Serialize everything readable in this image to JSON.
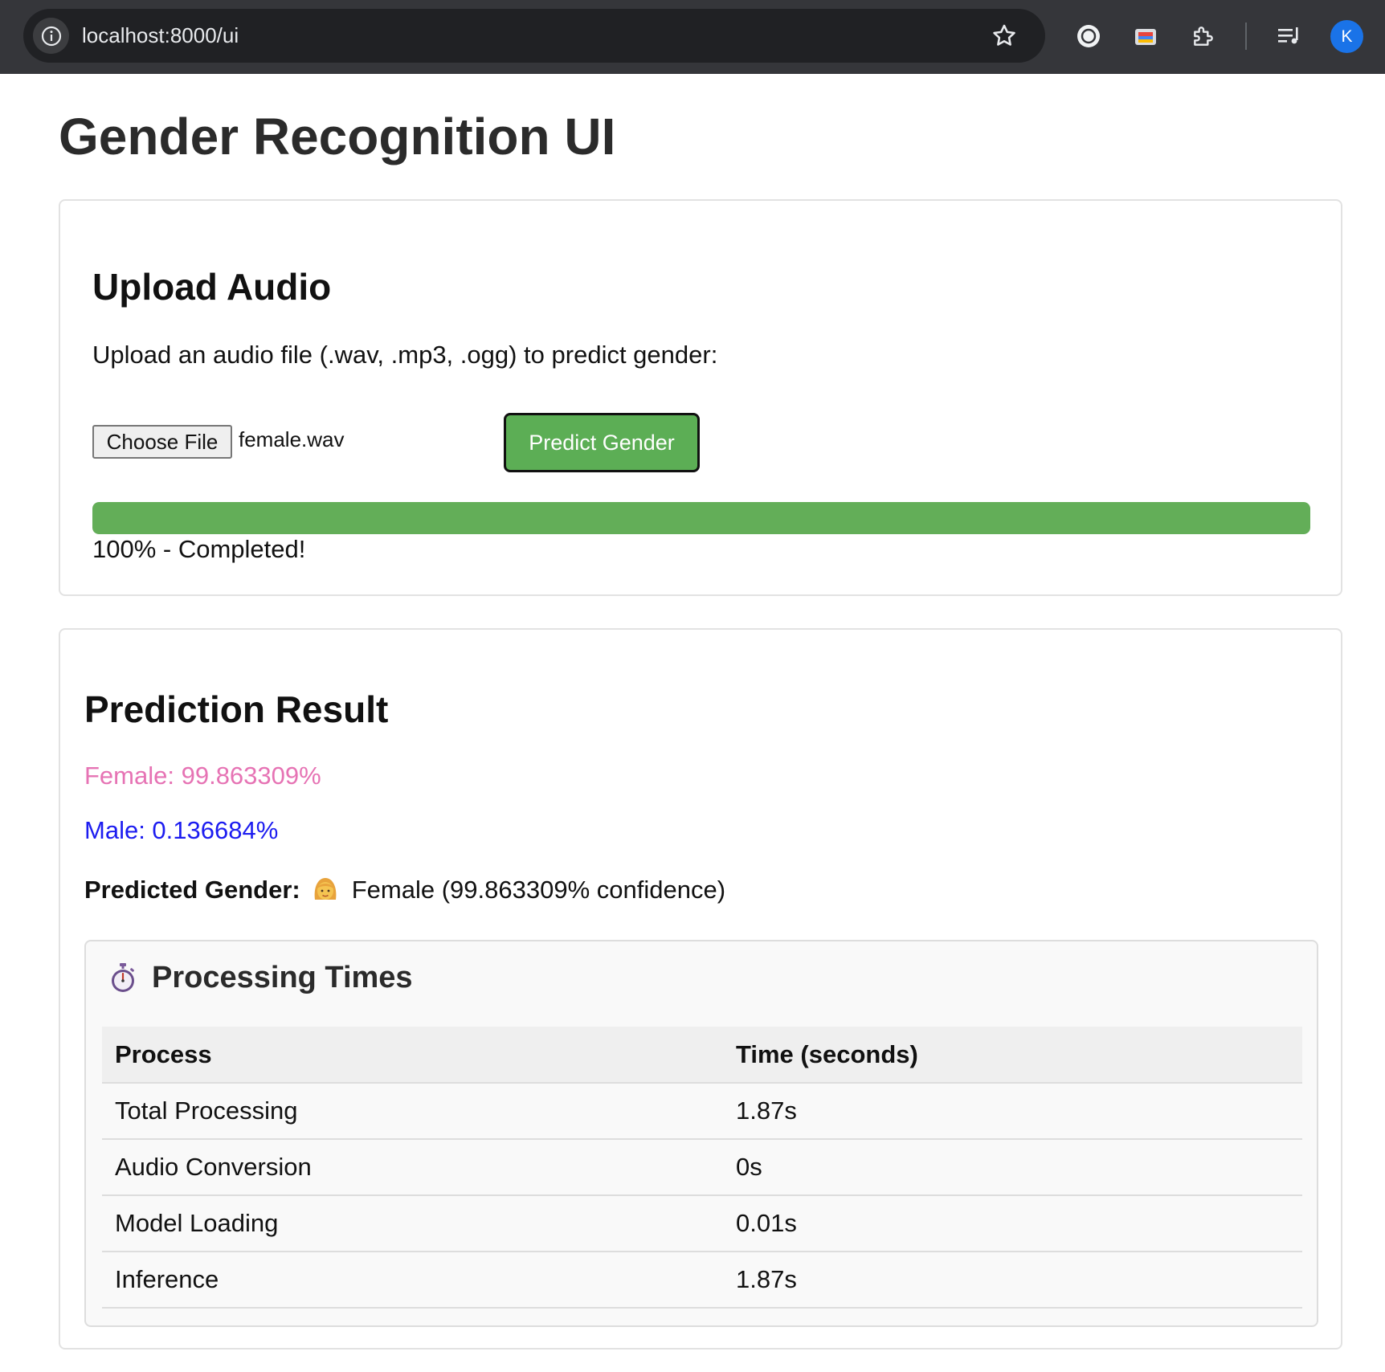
{
  "browser": {
    "url": "localhost:8000/ui",
    "profile_initial": "K",
    "icons": [
      "site-info-icon",
      "bookmark-star-icon",
      "extension-record-icon",
      "extension-palette-icon",
      "extensions-puzzle-icon",
      "reading-list-icon"
    ]
  },
  "page": {
    "title": "Gender Recognition UI"
  },
  "upload": {
    "title": "Upload Audio",
    "description": "Upload an audio file (.wav, .mp3, .ogg) to predict gender:",
    "choose_file_label": "Choose File",
    "file_name": "female.wav",
    "predict_label": "Predict Gender",
    "progress_percent": 100,
    "progress_text": "100% - Completed!",
    "colors": {
      "button": "#5cae55",
      "progress": "#63ae58"
    }
  },
  "result": {
    "title": "Prediction Result",
    "female_text": "Female: 99.863309%",
    "male_text": "Male: 0.136684%",
    "predicted_label": "Predicted Gender:",
    "predicted_icon": "woman-face-icon",
    "predicted_value": "Female (99.863309% confidence)",
    "colors": {
      "female": "#e673b4",
      "male": "#1c1cf0"
    }
  },
  "processing": {
    "icon": "stopwatch-icon",
    "title": "Processing Times",
    "headers": [
      "Process",
      "Time (seconds)"
    ],
    "rows": [
      {
        "process": "Total Processing",
        "time": "1.87s"
      },
      {
        "process": "Audio Conversion",
        "time": "0s"
      },
      {
        "process": "Model Loading",
        "time": "0.01s"
      },
      {
        "process": "Inference",
        "time": "1.87s"
      }
    ]
  }
}
